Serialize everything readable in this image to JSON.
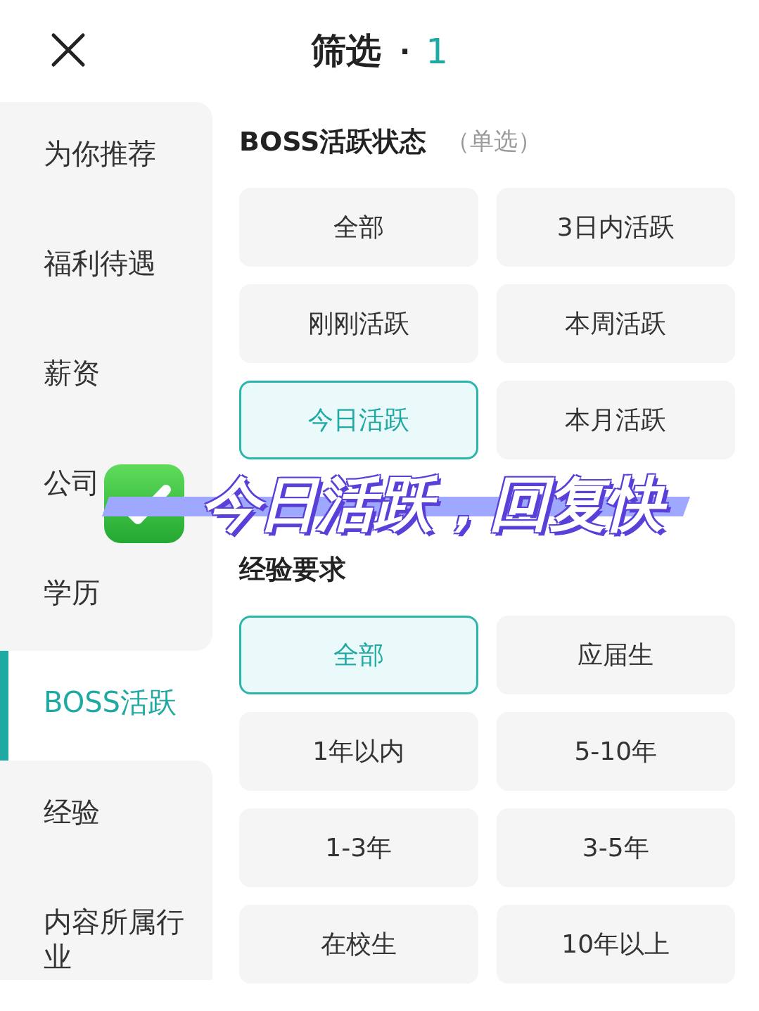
{
  "header": {
    "title": "筛选",
    "separator": "·",
    "count": "1"
  },
  "sidebar": {
    "items": [
      {
        "label": "为你推荐",
        "selected": false
      },
      {
        "label": "福利待遇",
        "selected": false
      },
      {
        "label": "薪资",
        "selected": false
      },
      {
        "label": "公司",
        "selected": false
      },
      {
        "label": "学历",
        "selected": false
      },
      {
        "label": "BOSS活跃",
        "selected": true
      },
      {
        "label": "经验",
        "selected": false
      },
      {
        "label": "内容所属行业",
        "selected": false
      }
    ]
  },
  "sections": [
    {
      "title": "BOSS活跃状态",
      "note": "（单选）",
      "options": [
        {
          "label": "全部",
          "selected": false
        },
        {
          "label": "3日内活跃",
          "selected": false
        },
        {
          "label": "刚刚活跃",
          "selected": false
        },
        {
          "label": "本周活跃",
          "selected": false
        },
        {
          "label": "今日活跃",
          "selected": true
        },
        {
          "label": "本月活跃",
          "selected": false
        }
      ]
    },
    {
      "title": "经验要求",
      "options": [
        {
          "label": "全部",
          "selected": true
        },
        {
          "label": "应届生",
          "selected": false
        },
        {
          "label": "1年以内",
          "selected": false
        },
        {
          "label": "5-10年",
          "selected": false
        },
        {
          "label": "1-3年",
          "selected": false
        },
        {
          "label": "3-5年",
          "selected": false
        },
        {
          "label": "在校生",
          "selected": false
        },
        {
          "label": "10年以上",
          "selected": false
        }
      ]
    }
  ],
  "overlay": {
    "caption": "今日活跃，回复快"
  }
}
